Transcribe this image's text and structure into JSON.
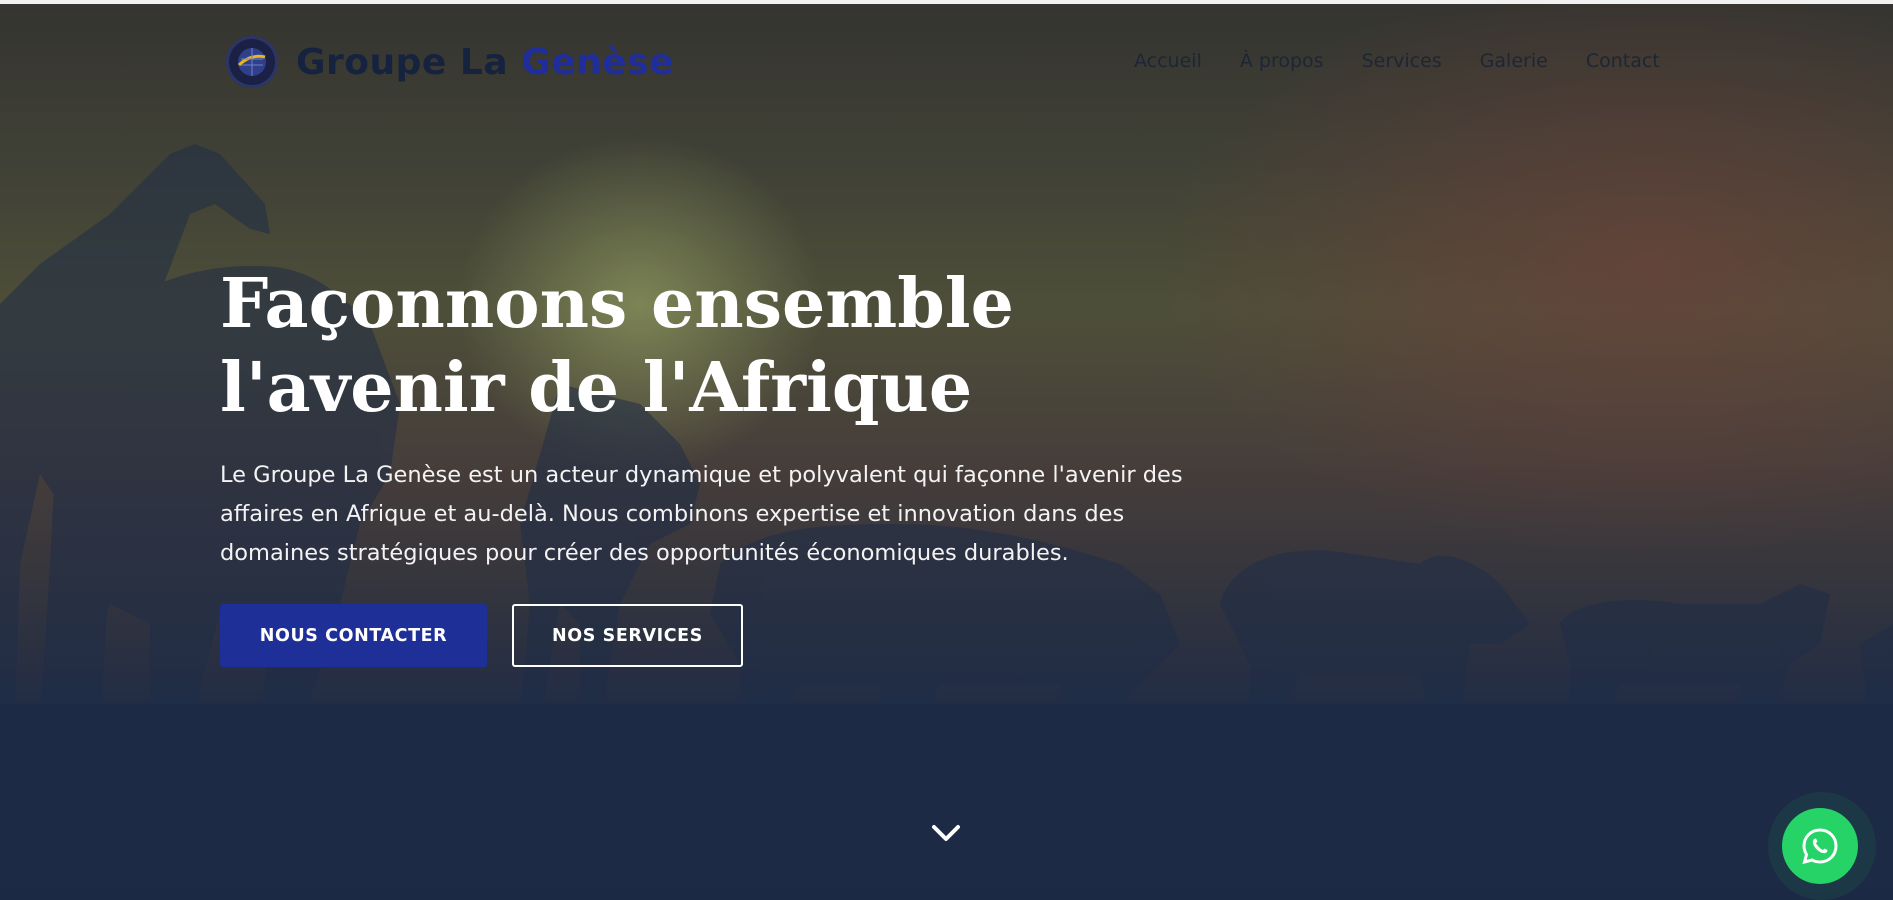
{
  "header": {
    "brand_main": "Groupe La",
    "brand_accent": "Genèse",
    "nav": [
      {
        "label": "Accueil"
      },
      {
        "label": "À propos"
      },
      {
        "label": "Services"
      },
      {
        "label": "Galerie"
      },
      {
        "label": "Contact"
      }
    ]
  },
  "hero": {
    "title": "Façonnons ensemble l'avenir de l'Afrique",
    "text": "Le Groupe La Genèse est un acteur dynamique et polyvalent qui façonne l'avenir des affaires en Afrique et au-delà. Nous combinons expertise et innovation dans des domaines stratégiques pour créer des opportunités économiques durables.",
    "primary_button": "NOUS CONTACTER",
    "secondary_button": "NOS SERVICES"
  },
  "colors": {
    "brand_dark": "#16233f",
    "brand_blue": "#1f2e9a",
    "primary_button": "#1e2f97",
    "whatsapp": "#25d366"
  },
  "icons": {
    "scroll": "chevron-down-icon",
    "whatsapp": "whatsapp-icon"
  }
}
